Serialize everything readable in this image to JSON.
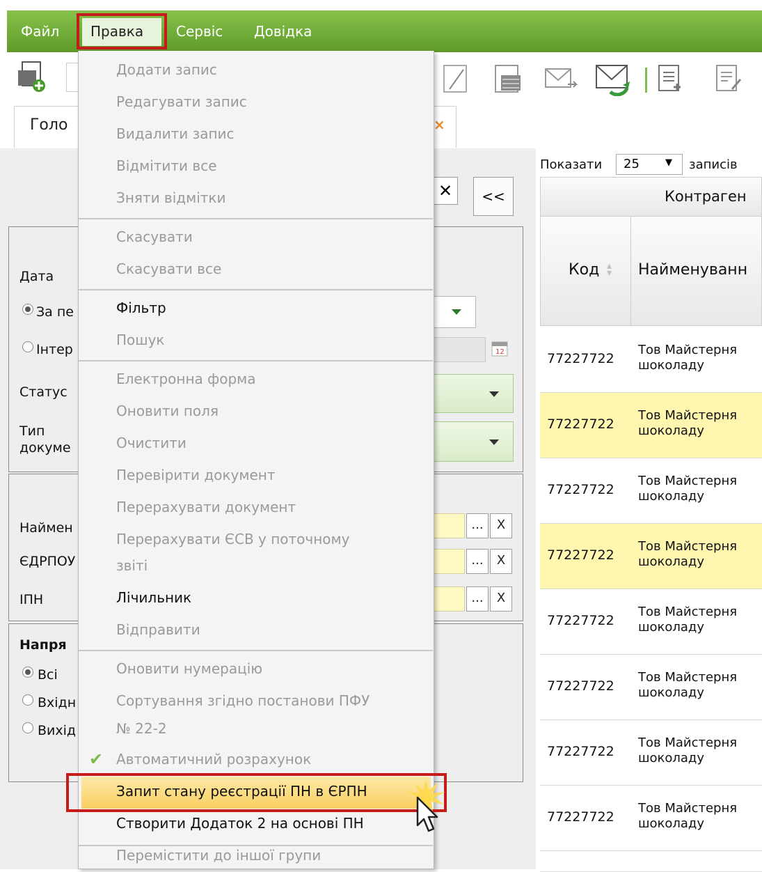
{
  "menubar": {
    "items": [
      "Файл",
      "Правка",
      "Сервіс",
      "Довідка"
    ]
  },
  "tabs": {
    "first_partial": "Голо"
  },
  "left_panel": {
    "nav_button": "<<",
    "close_glyph": "✕",
    "date_label": "Дата",
    "radio_period": "За пе",
    "radio_interval": "Інтер",
    "status_label": "Статус",
    "doctype_label_line1": "Тип",
    "doctype_label_line2": "докуме",
    "name_label": "Наймен",
    "edrpou_label": "ЄДРПОУ",
    "ipn_label": "ІПН",
    "ellipsis": "...",
    "clear": "X",
    "direction_title": "Напря",
    "dir_all": "Всі",
    "dir_in": "Вхідн",
    "dir_out": "Вихід"
  },
  "table": {
    "show_label": "Показати",
    "page_size": "25",
    "records_label": "записів",
    "header_group": "Контраген",
    "col_code": "Код",
    "col_name": "Найменуванн",
    "rows": [
      {
        "code": "77227722",
        "name1": "Тов Майстерня",
        "name2": "шоколаду",
        "hl": false
      },
      {
        "code": "77227722",
        "name1": "Тов Майстерня",
        "name2": "шоколаду",
        "hl": true
      },
      {
        "code": "77227722",
        "name1": "Тов Майстерня",
        "name2": "шоколаду",
        "hl": false
      },
      {
        "code": "77227722",
        "name1": "Тов Майстерня",
        "name2": "шоколаду",
        "hl": true
      },
      {
        "code": "77227722",
        "name1": "Тов Майстерня",
        "name2": "шоколаду",
        "hl": false
      },
      {
        "code": "77227722",
        "name1": "Тов Майстерня",
        "name2": "шоколаду",
        "hl": false
      },
      {
        "code": "77227722",
        "name1": "Тов Майстерня",
        "name2": "шоколаду",
        "hl": false
      },
      {
        "code": "77227722",
        "name1": "Тов Майстерня",
        "name2": "шоколаду",
        "hl": false
      }
    ]
  },
  "dropdown": {
    "items": [
      {
        "label": "Додати запис",
        "enabled": false
      },
      {
        "label": "Редагувати запис",
        "enabled": false
      },
      {
        "label": "Видалити запис",
        "enabled": false
      },
      {
        "label": "Відмітити все",
        "enabled": false
      },
      {
        "label": "Зняти відмітки",
        "enabled": false
      },
      {
        "label": "Скасувати",
        "enabled": false
      },
      {
        "label": "Скасувати все",
        "enabled": false
      },
      {
        "label": "Фільтр",
        "enabled": true
      },
      {
        "label": "Пошук",
        "enabled": false
      },
      {
        "label": "Електронна форма",
        "enabled": false
      },
      {
        "label": "Оновити поля",
        "enabled": false
      },
      {
        "label": "Очистити",
        "enabled": false
      },
      {
        "label": "Перевірити документ",
        "enabled": false
      },
      {
        "label": "Перерахувати документ",
        "enabled": false
      },
      {
        "label": "Перерахувати ЄСВ у поточному",
        "enabled": false
      },
      {
        "label": "звіті",
        "enabled": false
      },
      {
        "label": "Лічильник",
        "enabled": true
      },
      {
        "label": "Відправити",
        "enabled": false
      },
      {
        "label": "Оновити нумерацію",
        "enabled": false
      },
      {
        "label": "Сортування згідно постанови ПФУ",
        "enabled": false
      },
      {
        "label": "№ 22-2",
        "enabled": false
      },
      {
        "label": "Автоматичний розрахунок",
        "enabled": false,
        "checked": true
      },
      {
        "label": "Запит стану реєстрації ПН в ЄРПН",
        "enabled": true,
        "highlighted": true
      },
      {
        "label": "Створити Додаток 2 на основі ПН",
        "enabled": true
      },
      {
        "label": "Перемістити до іншої групи",
        "enabled": false
      }
    ]
  },
  "colors": {
    "menubar": "#6fae35",
    "highlight_frame": "#c51b1b",
    "row_highlight": "#fff7b0",
    "check": "#7dbb4a"
  }
}
